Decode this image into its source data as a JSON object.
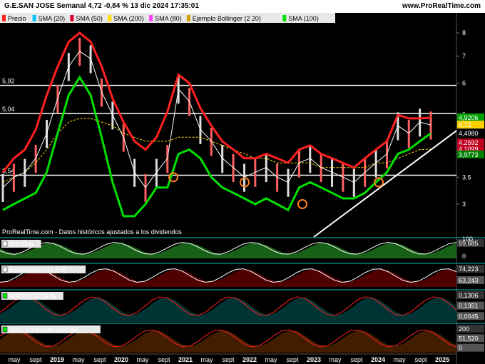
{
  "header": {
    "title": "G.E.SAN JOSE Semanal 4,72 -0,84 % 13 dic 2024 17:35:01",
    "site": "www.ProRealTime.com"
  },
  "legend": [
    {
      "label": "Precio",
      "color": "#ff2020"
    },
    {
      "label": "SMA (20)",
      "color": "#00c8ff"
    },
    {
      "label": "SMA (50)",
      "color": "#e00030"
    },
    {
      "label": "SMA (200)",
      "color": "#ffe000"
    },
    {
      "label": "SMA (80)",
      "color": "#ff40ff"
    },
    {
      "label": "Ejemplo Bollinger (2 20)",
      "color": "#d0a000"
    },
    {
      "label": "SMA (100)",
      "color": "#00e000"
    }
  ],
  "watermark": "ProRealTime.com - Datos históricos ajustados a los dividendos",
  "chart_data": {
    "type": "line",
    "price_axis": {
      "ticks": [
        "8",
        "7",
        "6",
        "5",
        "4",
        "3.5",
        "3"
      ]
    },
    "hlines": [
      {
        "label": "5,92",
        "value": 5.92
      },
      {
        "label": "5,04",
        "value": 5.04
      },
      {
        "label": "3,54",
        "value": 3.54
      }
    ],
    "right_labels": [
      {
        "text": "4,9206",
        "value": 4.92,
        "bg": "#00a000"
      },
      {
        "text": "4,72",
        "value": 4.72,
        "bg": "#ffd000"
      },
      {
        "text": "4,4980",
        "value": 4.5,
        "bg": "#000000"
      },
      {
        "text": "4,2592",
        "value": 4.26,
        "bg": "#c00020"
      },
      {
        "text": "4,1099",
        "value": 4.11,
        "bg": "#c00020"
      },
      {
        "text": "3,9773",
        "value": 3.98,
        "bg": "#008000"
      }
    ],
    "x_ticks": [
      "may",
      "sept",
      "2019",
      "may",
      "sept",
      "2020",
      "may",
      "sept",
      "2021",
      "may",
      "sept",
      "2022",
      "may",
      "sept",
      "2023",
      "may",
      "sept",
      "2024",
      "may",
      "sept",
      "2025"
    ],
    "price_series": [
      3.3,
      3.5,
      3.6,
      3.9,
      4.5,
      5.5,
      6.6,
      7.2,
      6.9,
      5.7,
      5.0,
      4.4,
      3.6,
      3.3,
      3.6,
      3.9,
      5.8,
      5.4,
      4.6,
      4.3,
      3.9,
      3.7,
      3.5,
      3.6,
      3.7,
      3.5,
      3.4,
      3.8,
      3.9,
      3.7,
      3.6,
      3.5,
      3.4,
      3.6,
      3.8,
      4.0,
      4.7,
      4.5,
      4.8,
      4.72
    ],
    "band_upper": [
      3.6,
      3.9,
      4.1,
      4.6,
      5.6,
      6.6,
      7.6,
      8.0,
      7.6,
      6.6,
      5.5,
      4.8,
      4.3,
      4.1,
      4.4,
      5.1,
      6.3,
      6.0,
      5.2,
      4.7,
      4.3,
      4.1,
      3.9,
      3.9,
      4.0,
      3.9,
      3.8,
      4.1,
      4.2,
      4.0,
      3.9,
      3.8,
      3.7,
      3.9,
      4.1,
      4.3,
      5.0,
      4.9,
      4.9,
      4.92
    ],
    "band_lower": [
      2.9,
      3.0,
      3.1,
      3.2,
      3.6,
      4.5,
      5.6,
      6.2,
      5.6,
      4.4,
      3.4,
      2.8,
      2.8,
      3.0,
      3.3,
      3.3,
      4.0,
      4.1,
      3.9,
      3.5,
      3.3,
      3.2,
      3.1,
      3.0,
      3.1,
      3.0,
      2.9,
      3.3,
      3.4,
      3.3,
      3.2,
      3.1,
      3.1,
      3.2,
      3.4,
      3.6,
      4.0,
      4.1,
      4.3,
      4.5
    ],
    "sma200": [
      3.4,
      3.5,
      3.6,
      3.8,
      4.1,
      4.5,
      4.8,
      4.9,
      4.9,
      4.8,
      4.7,
      4.5,
      4.4,
      4.3,
      4.3,
      4.3,
      4.4,
      4.4,
      4.4,
      4.3,
      4.2,
      4.1,
      4.0,
      3.9,
      3.9,
      3.8,
      3.8,
      3.8,
      3.8,
      3.7,
      3.7,
      3.7,
      3.7,
      3.7,
      3.8,
      3.8,
      3.9,
      4.0,
      4.1,
      4.11
    ],
    "rsi": {
      "label": "RSI (14)",
      "value": "59,685",
      "ticks": [
        "100",
        "0"
      ]
    },
    "stoch": {
      "label": "Estocástico (14 3 5)",
      "values": [
        "74,223",
        "63,243"
      ]
    },
    "macd": {
      "label": "MACD (12 26 9)",
      "values": [
        "0,1306",
        "0,1351",
        "0,0045"
      ]
    },
    "koncorde": {
      "label": "Blai5 Koncorde v.09 (15)",
      "values": [
        "200",
        "51,520",
        "0"
      ]
    }
  }
}
